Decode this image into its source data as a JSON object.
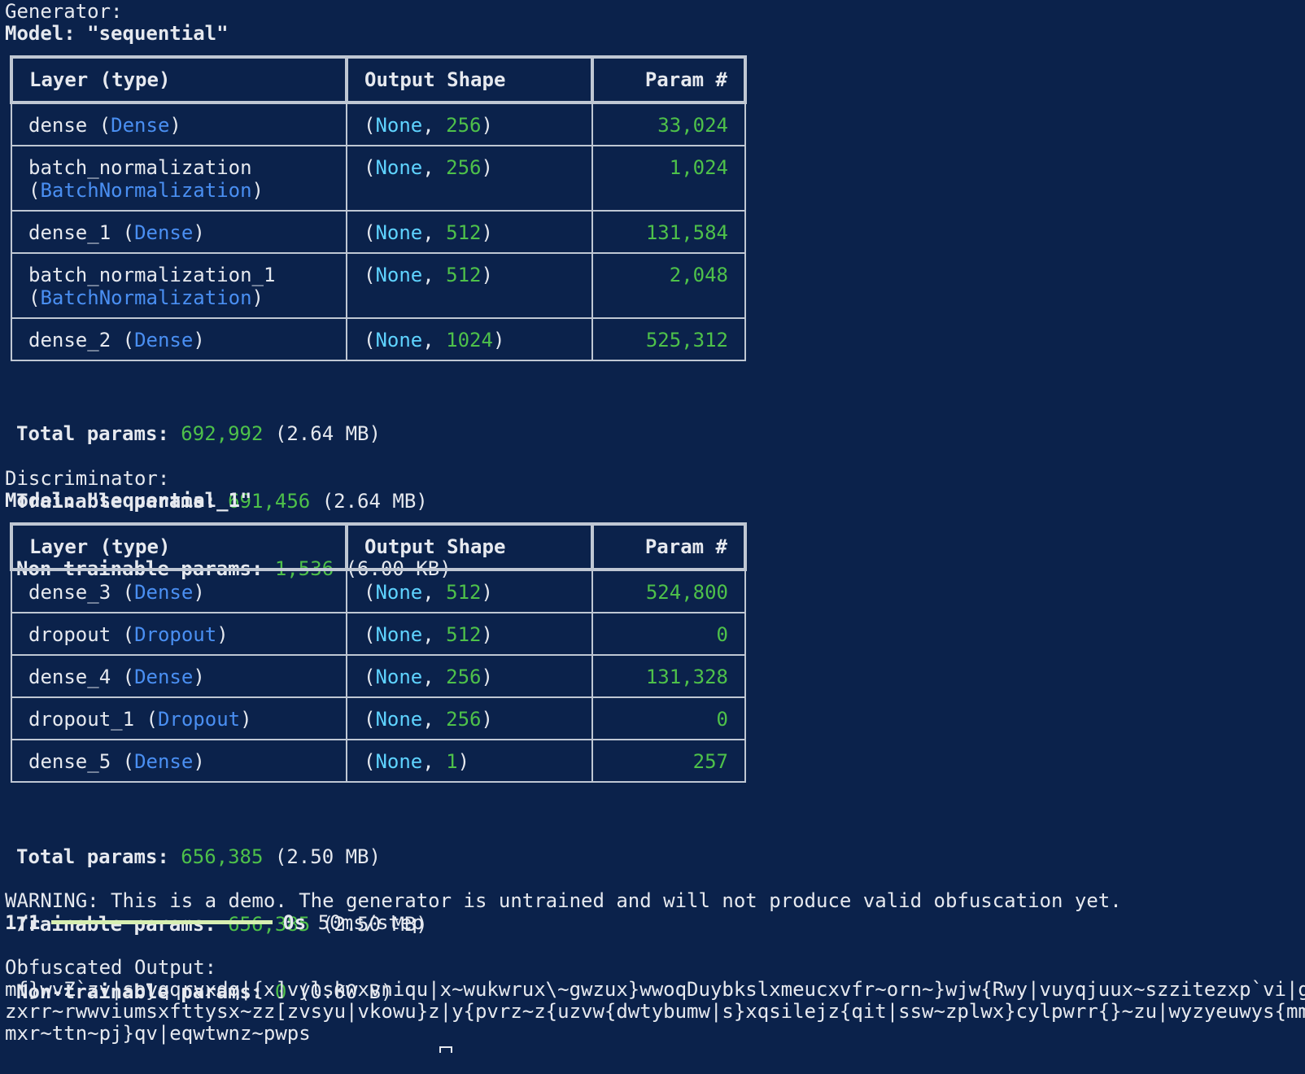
{
  "generator": {
    "heading": "Generator:",
    "model_line": "Model: \"sequential\"",
    "table": {
      "headers": [
        "Layer (type)",
        "Output Shape",
        "Param #"
      ],
      "rows": [
        {
          "name": "dense",
          "type": "Dense",
          "shape_none": "None",
          "shape_dim": "256",
          "params": "33,024"
        },
        {
          "name": "batch_normalization",
          "type": "BatchNormalization",
          "shape_none": "None",
          "shape_dim": "256",
          "params": "1,024"
        },
        {
          "name": "dense_1",
          "type": "Dense",
          "shape_none": "None",
          "shape_dim": "512",
          "params": "131,584"
        },
        {
          "name": "batch_normalization_1",
          "type": "BatchNormalization",
          "shape_none": "None",
          "shape_dim": "512",
          "params": "2,048"
        },
        {
          "name": "dense_2",
          "type": "Dense",
          "shape_none": "None",
          "shape_dim": "1024",
          "params": "525,312"
        }
      ]
    },
    "summary": {
      "total_label": "Total params:",
      "total_value": "692,992",
      "total_size": "(2.64 MB)",
      "trainable_label": "Trainable params:",
      "trainable_value": "691,456",
      "trainable_size": "(2.64 MB)",
      "nontrainable_label": "Non-trainable params:",
      "nontrainable_value": "1,536",
      "nontrainable_size": "(6.00 KB)"
    }
  },
  "discriminator": {
    "heading": "Discriminator:",
    "model_line": "Model: \"sequential_1\"",
    "table": {
      "headers": [
        "Layer (type)",
        "Output Shape",
        "Param #"
      ],
      "rows": [
        {
          "name": "dense_3",
          "type": "Dense",
          "shape_none": "None",
          "shape_dim": "512",
          "params": "524,800"
        },
        {
          "name": "dropout",
          "type": "Dropout",
          "shape_none": "None",
          "shape_dim": "512",
          "params": "0"
        },
        {
          "name": "dense_4",
          "type": "Dense",
          "shape_none": "None",
          "shape_dim": "256",
          "params": "131,328"
        },
        {
          "name": "dropout_1",
          "type": "Dropout",
          "shape_none": "None",
          "shape_dim": "256",
          "params": "0"
        },
        {
          "name": "dense_5",
          "type": "Dense",
          "shape_none": "None",
          "shape_dim": "1",
          "params": "257"
        }
      ]
    },
    "summary": {
      "total_label": "Total params:",
      "total_value": "656,385",
      "total_size": "(2.50 MB)",
      "trainable_label": "Trainable params:",
      "trainable_value": "656,385",
      "trainable_size": "(2.50 MB)",
      "nontrainable_label": "Non-trainable params:",
      "nontrainable_value": "0",
      "nontrainable_size": "(0.00 B)"
    }
  },
  "warning": "WARNING: This is a demo. The generator is untrained and will not produce valid obfuscation yet.",
  "progress": {
    "step": "1/1",
    "fraction": 1.0,
    "timing_bold": "0s",
    "timing": "50ms/step"
  },
  "output": {
    "heading": "Obfuscated Output:",
    "lines": [
      "mf}wvZ`zv|soyqqrvxdq|{x]vylskwxvniqu|x~wukwrux\\~gwzux}wwoqDuybkslxmeucxvfr~orn~}wjw{Rwy|vuyqjuux~szzitezxp`vi|gm{l",
      "zxrr~rwwviumsxfttysx~zz[zvsyu|vkowu}z|y{pvrz~z{uzvw{dwtybumw|s}xqsilejz{qit|ssw~zplwx}cylpwrr{}~zu|wyzyeuwys{mmwnt",
      "mxr~ttn~pj}qv|eqwtwnz~pwps"
    ]
  }
}
